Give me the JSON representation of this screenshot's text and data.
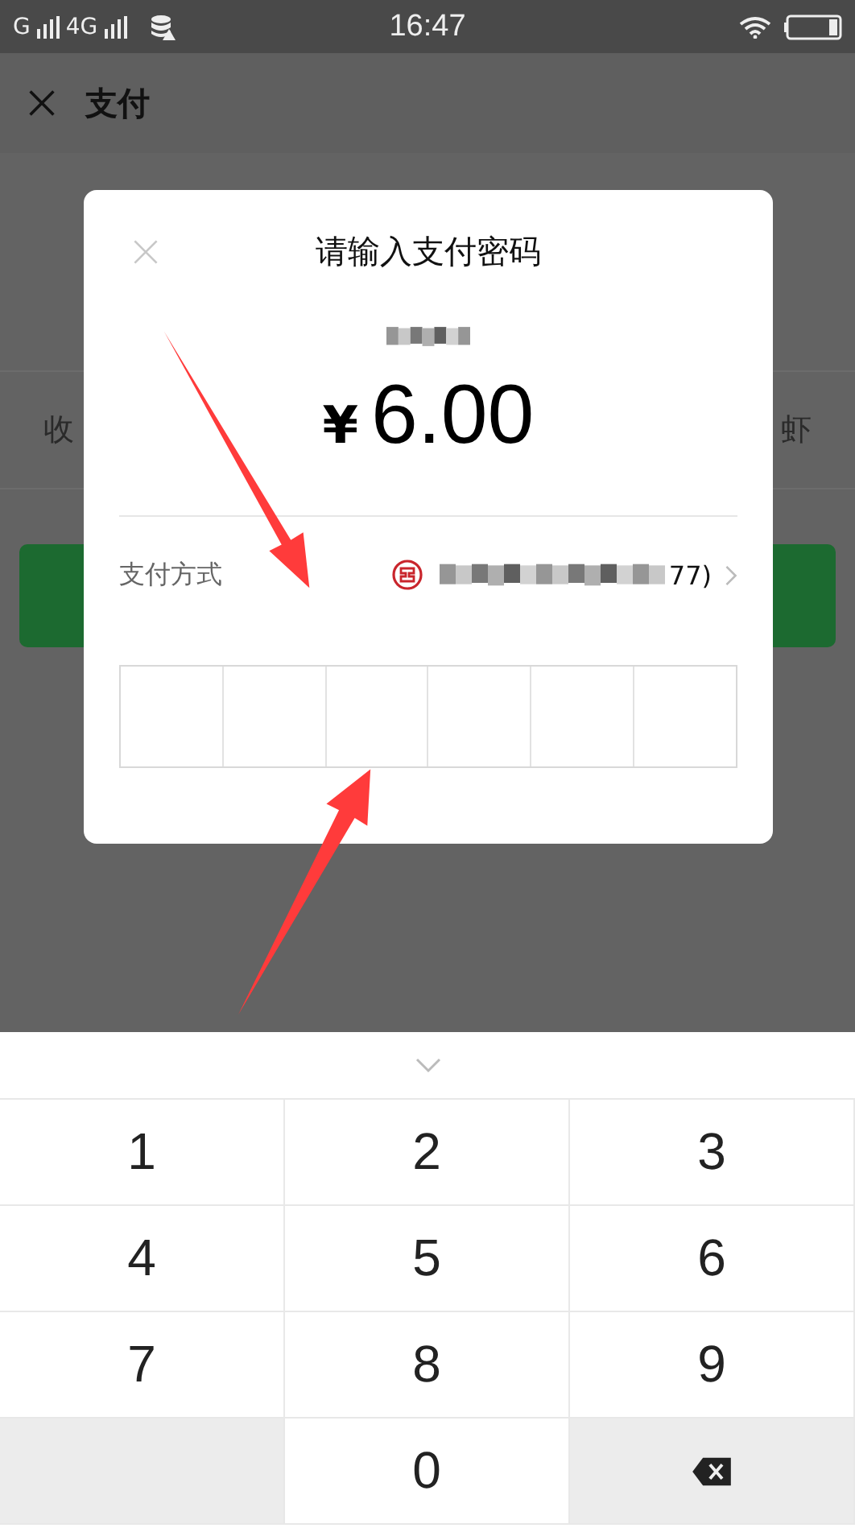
{
  "status_bar": {
    "network_1": "G",
    "network_2": "4G",
    "time": "16:47"
  },
  "header": {
    "title": "支付"
  },
  "background": {
    "left_text": "收",
    "right_text": "虾"
  },
  "dialog": {
    "title": "请输入支付密码",
    "currency": "¥",
    "amount": "6.00",
    "payment_label": "支付方式",
    "card_suffix": "77)"
  },
  "keypad": [
    {
      "kind": "digit",
      "label": "1"
    },
    {
      "kind": "digit",
      "label": "2"
    },
    {
      "kind": "digit",
      "label": "3"
    },
    {
      "kind": "digit",
      "label": "4"
    },
    {
      "kind": "digit",
      "label": "5"
    },
    {
      "kind": "digit",
      "label": "6"
    },
    {
      "kind": "digit",
      "label": "7"
    },
    {
      "kind": "digit",
      "label": "8"
    },
    {
      "kind": "digit",
      "label": "9"
    },
    {
      "kind": "blank"
    },
    {
      "kind": "digit",
      "label": "0"
    },
    {
      "kind": "delete"
    }
  ]
}
